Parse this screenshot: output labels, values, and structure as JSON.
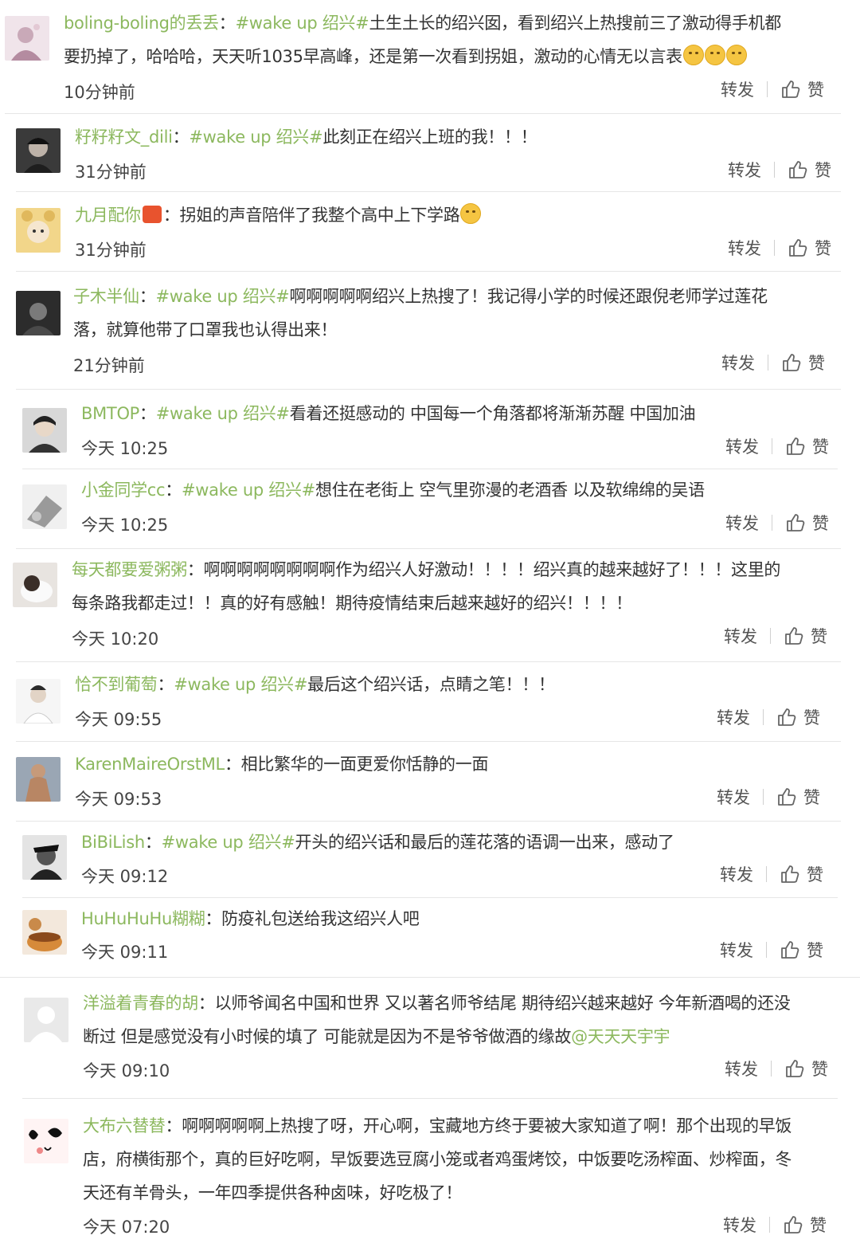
{
  "comments": [
    {
      "username": "boling-boling的丢丢",
      "topic": "#wake up 绍兴#",
      "text": "土生土长的绍兴囡，看到绍兴上热搜前三了激动得手机都",
      "text2": "要扔掉了，哈哈哈，天天听1035早高峰，还是第一次看到拐姐，激动的心情无以言表",
      "emoji_count": 3,
      "time": "10分钟前",
      "forward": "转发",
      "like": "赞"
    },
    {
      "username": "籽籽籽文_dili",
      "topic": "#wake up 绍兴#",
      "text": "此刻正在绍兴上班的我！！！",
      "time": "31分钟前",
      "forward": "转发",
      "like": "赞"
    },
    {
      "username": "九月配你",
      "text": "拐姐的声音陪伴了我整个高中上下学路",
      "time": "31分钟前",
      "forward": "转发",
      "like": "赞"
    },
    {
      "username": "子木半仙",
      "topic": "#wake up 绍兴#",
      "text": "啊啊啊啊啊绍兴上热搜了！我记得小学的时候还跟倪老师学过莲花",
      "text2": "落，就算他带了口罩我也认得出来！",
      "time": "21分钟前",
      "forward": "转发",
      "like": "赞"
    },
    {
      "username": "BMTOP",
      "topic": "#wake up 绍兴#",
      "text": "看着还挺感动的 中国每一个角落都将渐渐苏醒 中国加油",
      "time": "今天 10:25",
      "forward": "转发",
      "like": "赞"
    },
    {
      "username": "小金同学cc",
      "topic": "#wake up 绍兴#",
      "text": "想住在老街上 空气里弥漫的老酒香 以及软绵绵的吴语",
      "time": "今天 10:25",
      "forward": "转发",
      "like": "赞"
    },
    {
      "username": "每天都要爱粥粥",
      "text": "啊啊啊啊啊啊啊啊作为绍兴人好激动！！！！绍兴真的越来越好了！！！这里的",
      "text2": "每条路我都走过！！真的好有感触！期待疫情结束后越来越好的绍兴！！！！",
      "time": "今天 10:20",
      "forward": "转发",
      "like": "赞"
    },
    {
      "username": "恰不到葡萄",
      "topic": "#wake up 绍兴#",
      "text": "最后这个绍兴话，点睛之笔！！！",
      "time": "今天 09:55",
      "forward": "转发",
      "like": "赞"
    },
    {
      "username": "KarenMaireOrstML",
      "text": "相比繁华的一面更爱你恬静的一面",
      "time": "今天 09:53",
      "forward": "转发",
      "like": "赞"
    },
    {
      "username": "BiBiLish",
      "topic": "#wake up 绍兴#",
      "text": "开头的绍兴话和最后的莲花落的语调一出来，感动了",
      "time": "今天 09:12",
      "forward": "转发",
      "like": "赞"
    },
    {
      "username": "HuHuHuHu糊糊",
      "text": "防疫礼包送给我这绍兴人吧",
      "time": "今天 09:11",
      "forward": "转发",
      "like": "赞"
    },
    {
      "username": "洋溢着青春的胡",
      "text": "以师爷闻名中国和世界 又以著名师爷结尾 期待绍兴越来越好 今年新酒喝的还没",
      "text2": "断过 但是感觉没有小时候的填了 可能就是因为不是爷爷做酒的缘故",
      "mention": "@天天天宇宇",
      "time": "今天 09:10",
      "forward": "转发",
      "like": "赞"
    },
    {
      "username": "大布六替替",
      "text": "啊啊啊啊啊上热搜了呀，开心啊，宝藏地方终于要被大家知道了啊！那个出现的早饭",
      "text2": "店，府横街那个，真的巨好吃啊，早饭要选豆腐小笼或者鸡蛋烤饺，中饭要吃汤榨面、炒榨面，冬",
      "text3": "天还有羊骨头，一年四季提供各种卤味，好吃极了！",
      "time": "今天 07:20",
      "forward": "转发",
      "like": "赞"
    }
  ],
  "colors": {
    "username": "#8cb85e",
    "text": "#333333",
    "divider": "#e6e6e6"
  },
  "icons": [
    "avatar",
    "thumbs-up-icon",
    "emoji-icon",
    "badge-icon"
  ]
}
